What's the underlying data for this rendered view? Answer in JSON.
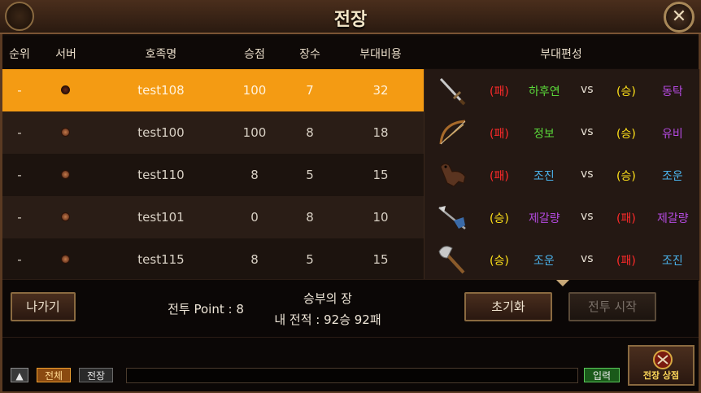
{
  "title": "전장",
  "columns": {
    "rank": "순위",
    "server": "서버",
    "name": "호족명",
    "points": "승점",
    "generals": "장수",
    "cost": "부대비용",
    "formation": "부대편성"
  },
  "rows": [
    {
      "rank": "-",
      "name": "test108",
      "points": "100",
      "generals": "7",
      "cost": "32",
      "unit_icon": "sword-icon",
      "left_result": "(패)",
      "left_general": "하후연",
      "vs": "vs",
      "right_result": "(승)",
      "right_general": "동탁"
    },
    {
      "rank": "-",
      "name": "test100",
      "points": "100",
      "generals": "8",
      "cost": "18",
      "unit_icon": "bow-icon",
      "left_result": "(패)",
      "left_general": "정보",
      "vs": "vs",
      "right_result": "(승)",
      "right_general": "유비"
    },
    {
      "rank": "-",
      "name": "test110",
      "points": "8",
      "generals": "5",
      "cost": "15",
      "unit_icon": "horse-icon",
      "left_result": "(패)",
      "left_general": "조진",
      "vs": "vs",
      "right_result": "(승)",
      "right_general": "조운"
    },
    {
      "rank": "-",
      "name": "test101",
      "points": "0",
      "generals": "8",
      "cost": "10",
      "unit_icon": "spear-icon",
      "left_result": "(승)",
      "left_general": "제갈량",
      "vs": "vs",
      "right_result": "(패)",
      "right_general": "제갈량"
    },
    {
      "rank": "-",
      "name": "test115",
      "points": "8",
      "generals": "5",
      "cost": "15",
      "unit_icon": "axe-icon",
      "left_result": "(승)",
      "left_general": "조운",
      "vs": "vs",
      "right_result": "(패)",
      "right_general": "조진"
    }
  ],
  "bottom": {
    "exit_label": "나가기",
    "battle_point": "전투 Point : 8",
    "arena_name": "승부의 장",
    "record": "내 전적 : 92승 92패",
    "reset_label": "초기화",
    "start_label": "전투 시작"
  },
  "chat": {
    "all_tab": "전체",
    "battle_tab": "전장",
    "input_label": "입력",
    "shop_label": "전장 상점"
  },
  "colors": {
    "selected_row": "#f49b13",
    "lose": "#ff2a2a",
    "win": "#ffe21a"
  }
}
